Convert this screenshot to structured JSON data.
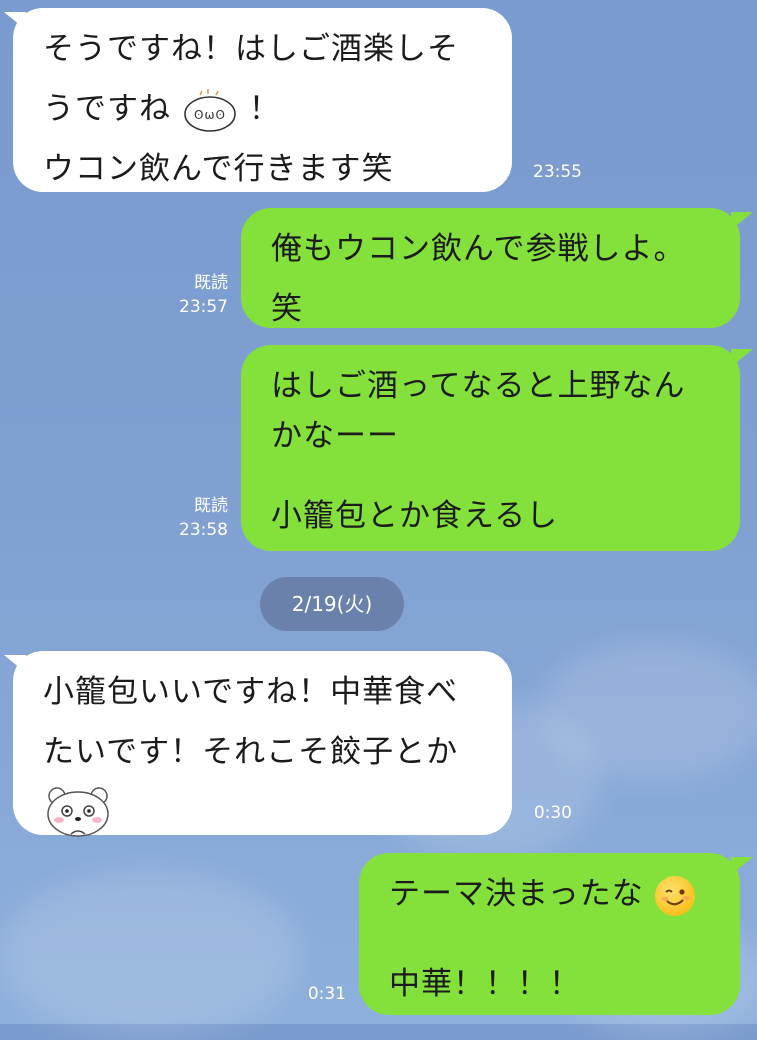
{
  "messages": [
    {
      "side": "in",
      "lines": [
        "そうですね！はしご酒楽しそ",
        "うですね",
        "ウコン飲んで行きます笑"
      ],
      "line2_suffix": "！",
      "sticker": "sweating-face-sticker-icon",
      "time": "23:55"
    },
    {
      "side": "out",
      "lines": [
        "俺もウコン飲んで参戦しよ。",
        "笑"
      ],
      "read": "既読",
      "time": "23:57"
    },
    {
      "side": "out",
      "lines": [
        "はしご酒ってなると上野なん",
        "かなーー",
        "",
        "小籠包とか食えるし"
      ],
      "read": "既読",
      "time": "23:58"
    },
    {
      "side": "in",
      "lines": [
        "小籠包いいですね！中華食べ",
        "たいです！それこそ餃子とか"
      ],
      "sticker": "bear-sticker-icon",
      "time": "0:30"
    },
    {
      "side": "out",
      "lines": [
        "テーマ決まったな",
        "",
        "中華！！！！"
      ],
      "emoji": "winking-face-icon",
      "time": "0:31"
    }
  ],
  "date_separator": "2/19(火)",
  "colors": {
    "incoming_bubble": "#ffffff",
    "outgoing_bubble": "#84e03a",
    "background": "#7f9fd1"
  }
}
